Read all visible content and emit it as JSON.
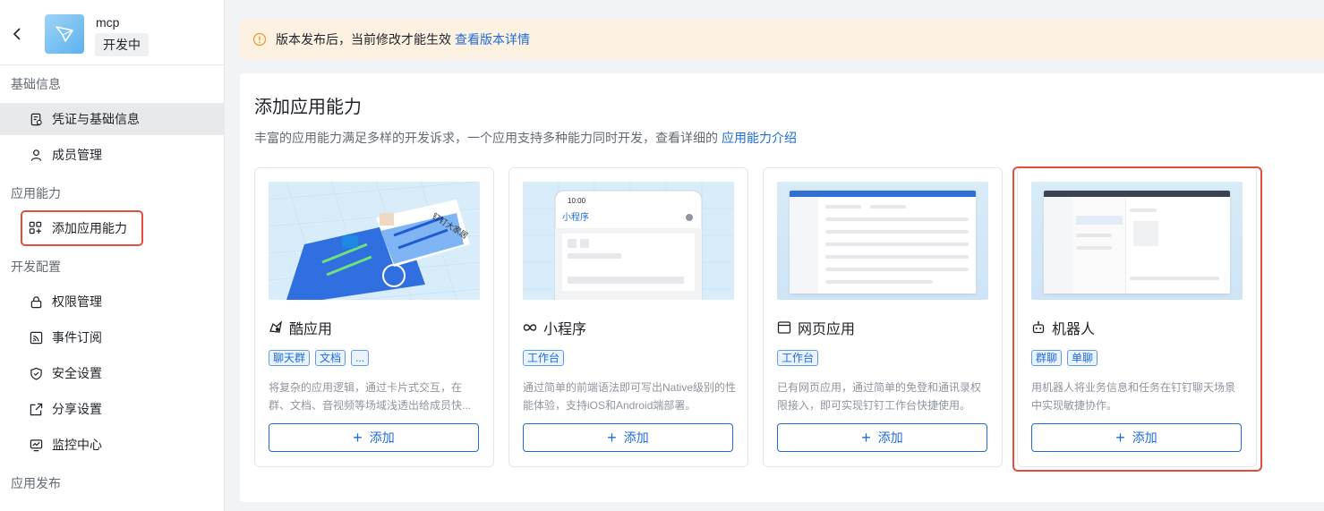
{
  "app": {
    "name": "mcp",
    "status": "开发中"
  },
  "sidebar": {
    "groups": [
      {
        "title": "基础信息",
        "items": [
          "凭证与基础信息",
          "成员管理"
        ]
      },
      {
        "title": "应用能力",
        "items": [
          "添加应用能力"
        ]
      },
      {
        "title": "开发配置",
        "items": [
          "权限管理",
          "事件订阅",
          "安全设置",
          "分享设置",
          "监控中心"
        ]
      },
      {
        "title": "应用发布",
        "items": []
      }
    ]
  },
  "notice": {
    "text": "版本发布后，当前修改才能生效",
    "link": "查看版本详情"
  },
  "panel": {
    "title": "添加应用能力",
    "desc": "丰富的应用能力满足多样的开发诉求，一个应用支持多种能力同时开发，查看详细的",
    "desc_link": "应用能力介绍",
    "add_label": "添加"
  },
  "cards": [
    {
      "title": "酷应用",
      "icon": "cool-app-icon",
      "tags": [
        "聊天群",
        "文档",
        "..."
      ],
      "desc": "将复杂的应用逻辑，通过卡片式交互，在群、文档、音视频等场域浅透出给成员快...",
      "thumb_text": "钉钉大家居"
    },
    {
      "title": "小程序",
      "icon": "mini-program-icon",
      "tags": [
        "工作台"
      ],
      "desc": "通过简单的前端语法即可写出Native级别的性能体验，支持iOS和Android端部署。",
      "thumb_time": "10:00",
      "thumb_title": "小程序"
    },
    {
      "title": "网页应用",
      "icon": "web-app-icon",
      "tags": [
        "工作台"
      ],
      "desc": "已有网页应用，通过简单的免登和通讯录权限接入，即可实现钉钉工作台快捷使用。"
    },
    {
      "title": "机器人",
      "icon": "robot-icon",
      "tags": [
        "群聊",
        "单聊"
      ],
      "desc": "用机器人将业务信息和任务在钉钉聊天场景中实现敏捷协作。"
    }
  ],
  "colors": {
    "accent": "#1f6cd8",
    "highlight": "#e34d3f",
    "notice_bg": "#fdf1e1"
  }
}
